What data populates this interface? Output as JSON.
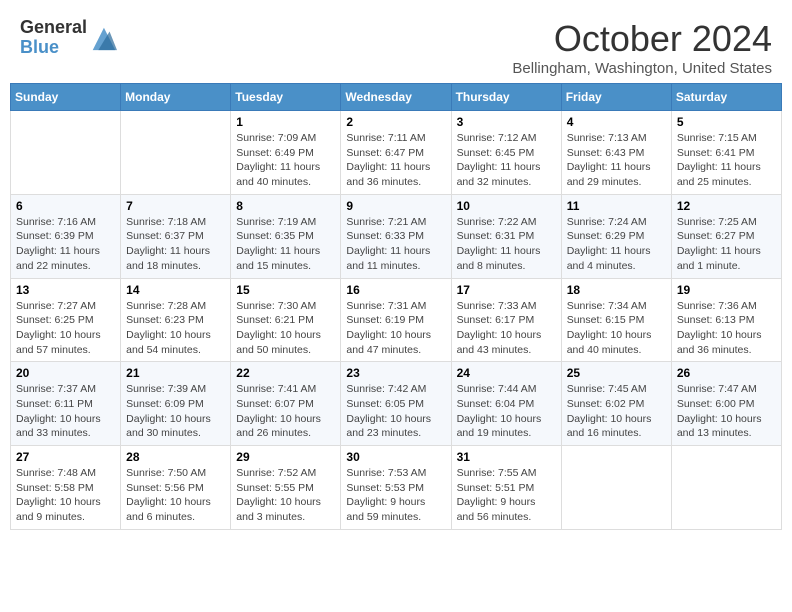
{
  "header": {
    "logo_general": "General",
    "logo_blue": "Blue",
    "title": "October 2024",
    "location": "Bellingham, Washington, United States"
  },
  "days_of_week": [
    "Sunday",
    "Monday",
    "Tuesday",
    "Wednesday",
    "Thursday",
    "Friday",
    "Saturday"
  ],
  "weeks": [
    [
      {
        "day": "",
        "info": ""
      },
      {
        "day": "",
        "info": ""
      },
      {
        "day": "1",
        "info": "Sunrise: 7:09 AM\nSunset: 6:49 PM\nDaylight: 11 hours and 40 minutes."
      },
      {
        "day": "2",
        "info": "Sunrise: 7:11 AM\nSunset: 6:47 PM\nDaylight: 11 hours and 36 minutes."
      },
      {
        "day": "3",
        "info": "Sunrise: 7:12 AM\nSunset: 6:45 PM\nDaylight: 11 hours and 32 minutes."
      },
      {
        "day": "4",
        "info": "Sunrise: 7:13 AM\nSunset: 6:43 PM\nDaylight: 11 hours and 29 minutes."
      },
      {
        "day": "5",
        "info": "Sunrise: 7:15 AM\nSunset: 6:41 PM\nDaylight: 11 hours and 25 minutes."
      }
    ],
    [
      {
        "day": "6",
        "info": "Sunrise: 7:16 AM\nSunset: 6:39 PM\nDaylight: 11 hours and 22 minutes."
      },
      {
        "day": "7",
        "info": "Sunrise: 7:18 AM\nSunset: 6:37 PM\nDaylight: 11 hours and 18 minutes."
      },
      {
        "day": "8",
        "info": "Sunrise: 7:19 AM\nSunset: 6:35 PM\nDaylight: 11 hours and 15 minutes."
      },
      {
        "day": "9",
        "info": "Sunrise: 7:21 AM\nSunset: 6:33 PM\nDaylight: 11 hours and 11 minutes."
      },
      {
        "day": "10",
        "info": "Sunrise: 7:22 AM\nSunset: 6:31 PM\nDaylight: 11 hours and 8 minutes."
      },
      {
        "day": "11",
        "info": "Sunrise: 7:24 AM\nSunset: 6:29 PM\nDaylight: 11 hours and 4 minutes."
      },
      {
        "day": "12",
        "info": "Sunrise: 7:25 AM\nSunset: 6:27 PM\nDaylight: 11 hours and 1 minute."
      }
    ],
    [
      {
        "day": "13",
        "info": "Sunrise: 7:27 AM\nSunset: 6:25 PM\nDaylight: 10 hours and 57 minutes."
      },
      {
        "day": "14",
        "info": "Sunrise: 7:28 AM\nSunset: 6:23 PM\nDaylight: 10 hours and 54 minutes."
      },
      {
        "day": "15",
        "info": "Sunrise: 7:30 AM\nSunset: 6:21 PM\nDaylight: 10 hours and 50 minutes."
      },
      {
        "day": "16",
        "info": "Sunrise: 7:31 AM\nSunset: 6:19 PM\nDaylight: 10 hours and 47 minutes."
      },
      {
        "day": "17",
        "info": "Sunrise: 7:33 AM\nSunset: 6:17 PM\nDaylight: 10 hours and 43 minutes."
      },
      {
        "day": "18",
        "info": "Sunrise: 7:34 AM\nSunset: 6:15 PM\nDaylight: 10 hours and 40 minutes."
      },
      {
        "day": "19",
        "info": "Sunrise: 7:36 AM\nSunset: 6:13 PM\nDaylight: 10 hours and 36 minutes."
      }
    ],
    [
      {
        "day": "20",
        "info": "Sunrise: 7:37 AM\nSunset: 6:11 PM\nDaylight: 10 hours and 33 minutes."
      },
      {
        "day": "21",
        "info": "Sunrise: 7:39 AM\nSunset: 6:09 PM\nDaylight: 10 hours and 30 minutes."
      },
      {
        "day": "22",
        "info": "Sunrise: 7:41 AM\nSunset: 6:07 PM\nDaylight: 10 hours and 26 minutes."
      },
      {
        "day": "23",
        "info": "Sunrise: 7:42 AM\nSunset: 6:05 PM\nDaylight: 10 hours and 23 minutes."
      },
      {
        "day": "24",
        "info": "Sunrise: 7:44 AM\nSunset: 6:04 PM\nDaylight: 10 hours and 19 minutes."
      },
      {
        "day": "25",
        "info": "Sunrise: 7:45 AM\nSunset: 6:02 PM\nDaylight: 10 hours and 16 minutes."
      },
      {
        "day": "26",
        "info": "Sunrise: 7:47 AM\nSunset: 6:00 PM\nDaylight: 10 hours and 13 minutes."
      }
    ],
    [
      {
        "day": "27",
        "info": "Sunrise: 7:48 AM\nSunset: 5:58 PM\nDaylight: 10 hours and 9 minutes."
      },
      {
        "day": "28",
        "info": "Sunrise: 7:50 AM\nSunset: 5:56 PM\nDaylight: 10 hours and 6 minutes."
      },
      {
        "day": "29",
        "info": "Sunrise: 7:52 AM\nSunset: 5:55 PM\nDaylight: 10 hours and 3 minutes."
      },
      {
        "day": "30",
        "info": "Sunrise: 7:53 AM\nSunset: 5:53 PM\nDaylight: 9 hours and 59 minutes."
      },
      {
        "day": "31",
        "info": "Sunrise: 7:55 AM\nSunset: 5:51 PM\nDaylight: 9 hours and 56 minutes."
      },
      {
        "day": "",
        "info": ""
      },
      {
        "day": "",
        "info": ""
      }
    ]
  ]
}
